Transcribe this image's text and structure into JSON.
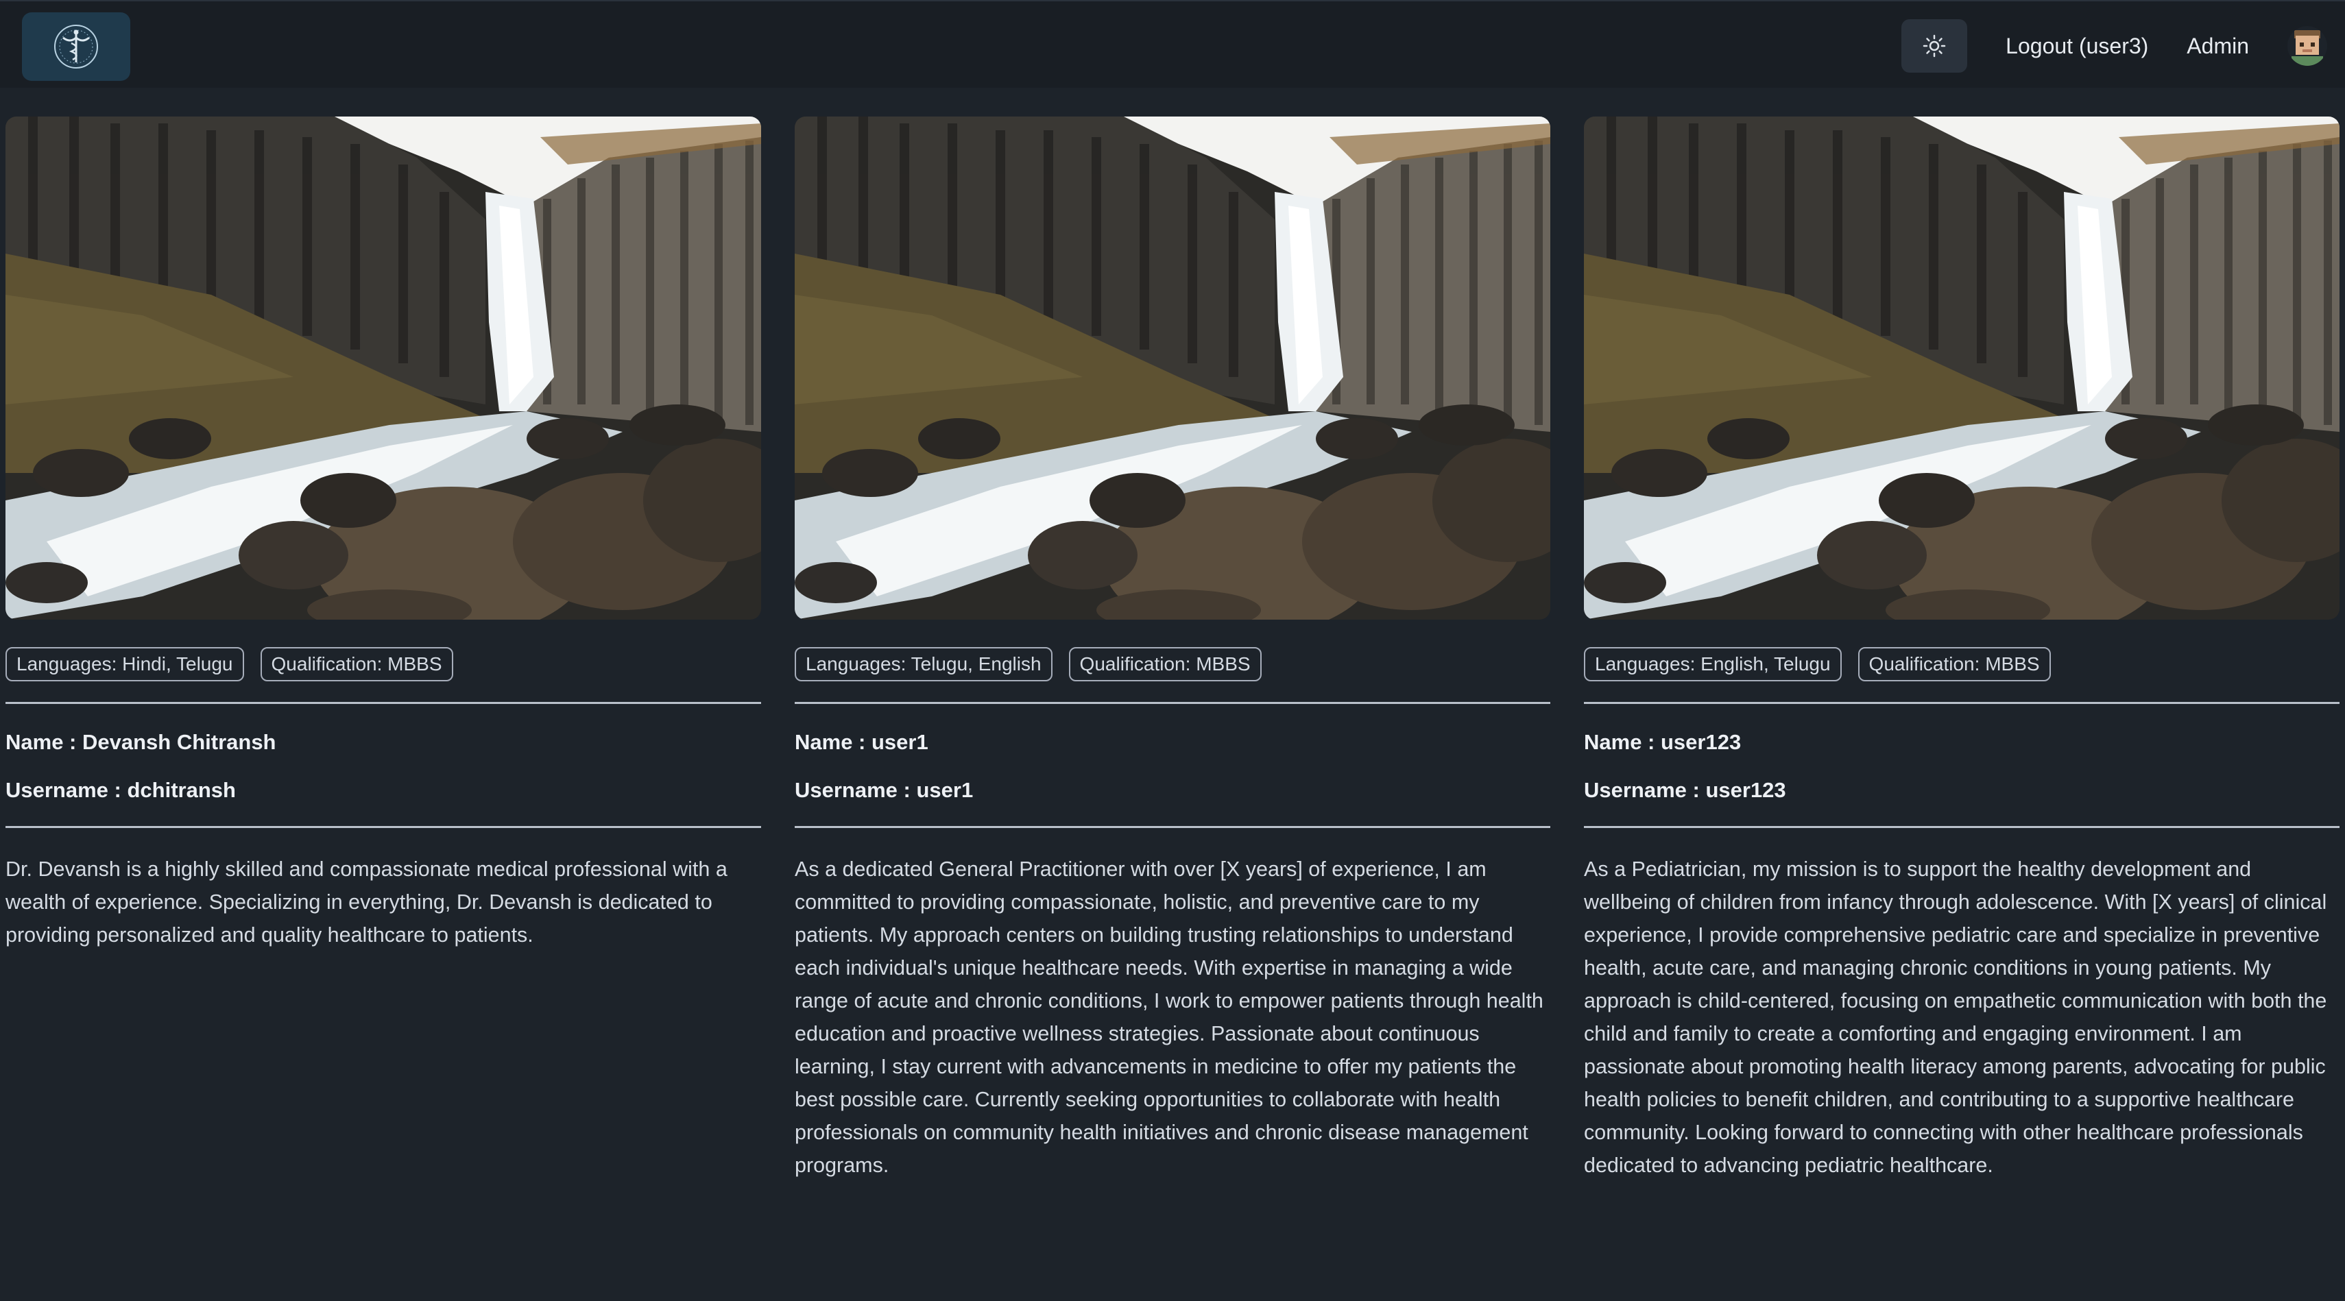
{
  "navbar": {
    "logo": {
      "icon": "caduceus-logo-icon"
    },
    "theme_toggle": {
      "icon": "sun-icon"
    },
    "logout_label": "Logout (user3)",
    "admin_label": "Admin",
    "avatar": {
      "icon": "user-avatar-icon"
    }
  },
  "cards": [
    {
      "photo": {
        "icon": "waterfall-photo"
      },
      "languages": "Languages: Hindi, Telugu",
      "qualification": "Qualification: MBBS",
      "name": "Name : Devansh Chitransh",
      "username": "Username : dchitransh",
      "bio": "Dr. Devansh is a highly skilled and compassionate medical professional with a wealth of experience. Specializing in everything, Dr. Devansh is dedicated to providing personalized and quality healthcare to patients."
    },
    {
      "photo": {
        "icon": "waterfall-photo"
      },
      "languages": "Languages: Telugu, English",
      "qualification": "Qualification: MBBS",
      "name": "Name : user1",
      "username": "Username : user1",
      "bio": "As a dedicated General Practitioner with over [X years] of experience, I am committed to providing compassionate, holistic, and preventive care to my patients. My approach centers on building trusting relationships to understand each individual's unique healthcare needs. With expertise in managing a wide range of acute and chronic conditions, I work to empower patients through health education and proactive wellness strategies. Passionate about continuous learning, I stay current with advancements in medicine to offer my patients the best possible care. Currently seeking opportunities to collaborate with health professionals on community health initiatives and chronic disease management programs."
    },
    {
      "photo": {
        "icon": "waterfall-photo"
      },
      "languages": "Languages: English, Telugu",
      "qualification": "Qualification: MBBS",
      "name": "Name : user123",
      "username": "Username : user123",
      "bio": "As a Pediatrician, my mission is to support the healthy development and wellbeing of children from infancy through adolescence. With [X years] of clinical experience, I provide comprehensive pediatric care and specialize in preventive health, acute care, and managing chronic conditions in young patients. My approach is child-centered, focusing on empathetic communication with both the child and family to create a comforting and engaging environment. I am passionate about promoting health literacy among parents, advocating for public health policies to benefit children, and contributing to a supportive healthcare community. Looking forward to connecting with other healthcare professionals dedicated to advancing pediatric healthcare."
    }
  ]
}
